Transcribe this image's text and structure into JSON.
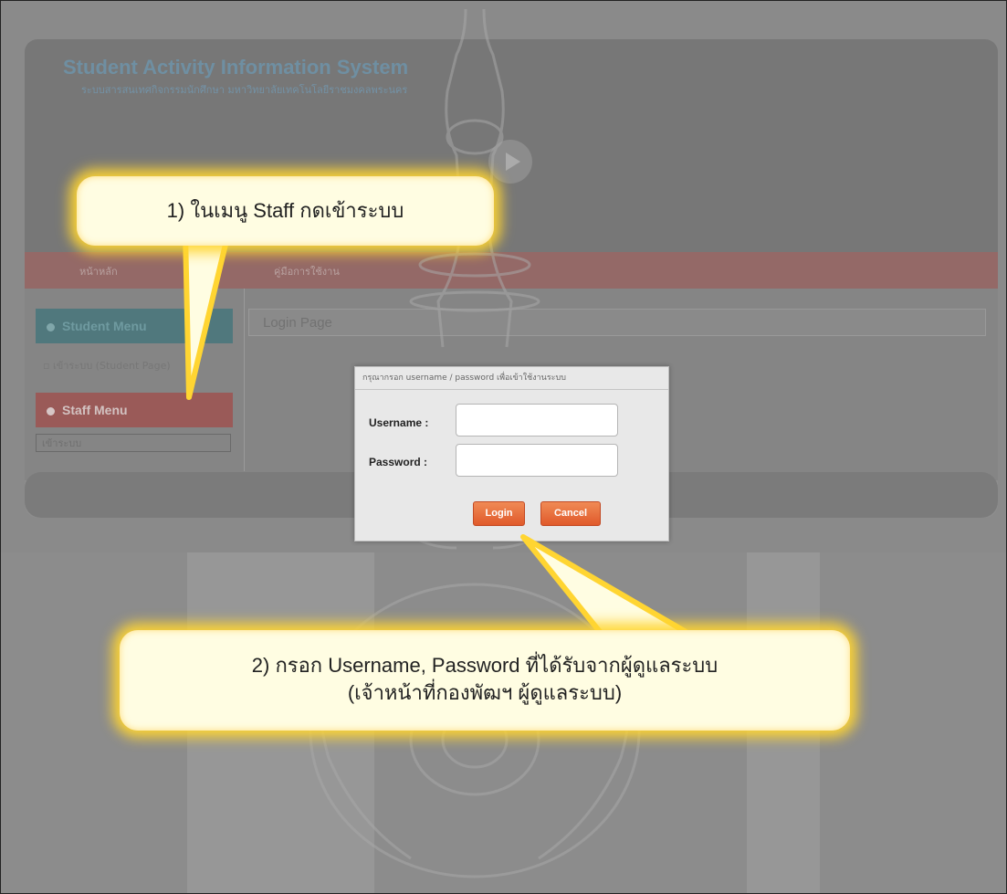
{
  "site": {
    "title": "Student Activity Information System",
    "subtitle": "ระบบสารสนเทศกิจกรรมนักศึกษา มหาวิทยาลัยเทคโนโลยีราชมงคลพระนคร",
    "nav": [
      "หน้าหลัก",
      "คู่มือการใช้งาน"
    ]
  },
  "sidebar": {
    "student_menu": "Student Menu",
    "student_link": "เข้าระบบ (Student Page)",
    "staff_menu": "Staff Menu",
    "staff_link": "เข้าระบบ"
  },
  "main": {
    "login_page_title": "Login Page"
  },
  "dialog": {
    "title": "กรุณากรอก username / password เพื่อเข้าใช้งานระบบ",
    "username_label": "Username :",
    "password_label": "Password :",
    "username_value": "",
    "password_value": "",
    "login_button": "Login",
    "cancel_button": "Cancel"
  },
  "callouts": {
    "step1": "1) ในเมนู Staff กดเข้าระบบ",
    "step2_line1": "2) กรอก Username, Password ที่ได้รับจากผู้ดูแลระบบ",
    "step2_line2": "(เจ้าหน้าที่กองพัฒฯ ผู้ดูแลระบบ)"
  },
  "colors": {
    "accent_button": "#e05a2b",
    "callout_glow": "#ffd532",
    "student_menu": "#50787d",
    "staff_menu": "#9a5a58"
  }
}
